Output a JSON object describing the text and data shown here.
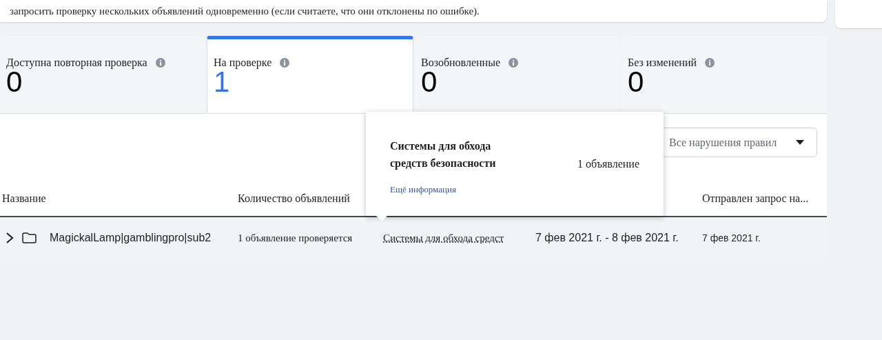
{
  "notice": {
    "text": "запросить проверку нескольких объявлений одновременно (если считаете, что они отклонены по ошибке)."
  },
  "tabs": [
    {
      "label": "Доступна повторная проверка",
      "count": "0",
      "selected": false
    },
    {
      "label": "На проверке",
      "count": "1",
      "selected": true
    },
    {
      "label": "Возобновленные",
      "count": "0",
      "selected": false
    },
    {
      "label": "Без изменений",
      "count": "0",
      "selected": false
    }
  ],
  "filter": {
    "value": "Все нарушения правил"
  },
  "table": {
    "columns": {
      "name": "Название",
      "ad_count": "Количество объявлений",
      "request_sent": "Отправлен запрос на..."
    },
    "rows": [
      {
        "expanded": false,
        "name": "MagickalLamp|gamblingpro|sub2",
        "ad_count": "1 объявление проверяется",
        "violation": "Системы для обхода средст",
        "dates": "7 фев 2021 г. - 8 фев 2021 г.",
        "request_sent": "7 фев 2021 г."
      }
    ]
  },
  "popover": {
    "title": "Системы для обхода средств безопасности",
    "count": "1 объявление",
    "link": "Ещё информация"
  }
}
